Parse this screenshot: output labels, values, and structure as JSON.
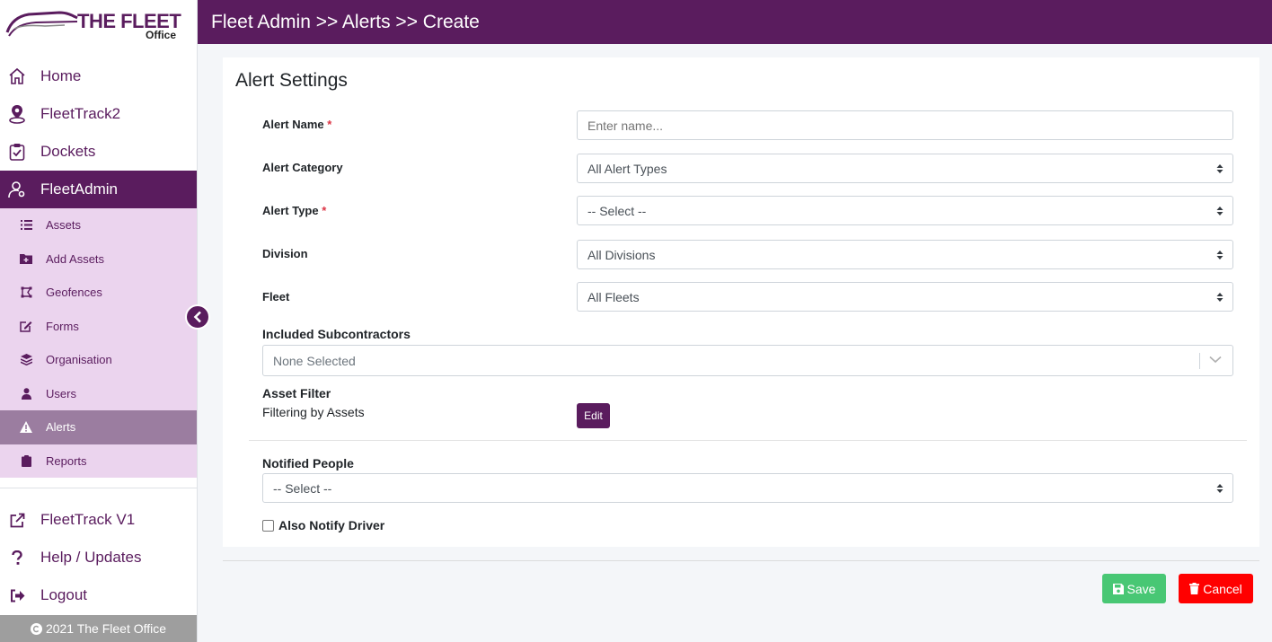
{
  "logo": {
    "brand": "THE FLEET",
    "sub": "Office"
  },
  "header": {
    "breadcrumb": "Fleet Admin >> Alerts >> Create"
  },
  "sidebar": {
    "main_items": [
      {
        "label": "Home",
        "icon": "home-icon"
      },
      {
        "label": "FleetTrack2",
        "icon": "map-pin-icon"
      },
      {
        "label": "Dockets",
        "icon": "clipboard-check-icon"
      },
      {
        "label": "FleetAdmin",
        "icon": "user-gear-icon",
        "active": true
      }
    ],
    "sub_items": [
      {
        "label": "Assets",
        "icon": "list-icon"
      },
      {
        "label": "Add Assets",
        "icon": "folder-plus-icon"
      },
      {
        "label": "Geofences",
        "icon": "draw-polygon-icon"
      },
      {
        "label": "Forms",
        "icon": "edit-icon"
      },
      {
        "label": "Organisation",
        "icon": "layers-icon"
      },
      {
        "label": "Users",
        "icon": "user-icon"
      },
      {
        "label": "Alerts",
        "icon": "warning-icon",
        "active": true
      },
      {
        "label": "Reports",
        "icon": "clipboard-icon"
      }
    ],
    "bottom_items": [
      {
        "label": "FleetTrack V1",
        "icon": "external-link-icon"
      },
      {
        "label": "Help / Updates",
        "icon": "question-icon"
      },
      {
        "label": "Logout",
        "icon": "sign-out-icon"
      }
    ],
    "footer": "2021 The Fleet Office"
  },
  "form": {
    "title": "Alert Settings",
    "alert_name": {
      "label": "Alert Name",
      "required": "*",
      "placeholder": "Enter name..."
    },
    "alert_category": {
      "label": "Alert Category",
      "value": "All Alert Types"
    },
    "alert_type": {
      "label": "Alert Type",
      "required": "*",
      "value": "-- Select --"
    },
    "division": {
      "label": "Division",
      "value": "All Divisions"
    },
    "fleet": {
      "label": "Fleet",
      "value": "All Fleets"
    },
    "subcontractors": {
      "label": "Included Subcontractors",
      "value": "None Selected"
    },
    "asset_filter": {
      "label": "Asset Filter",
      "text": "Filtering by Assets",
      "button": "Edit"
    },
    "notified_people": {
      "label": "Notified People",
      "value": "-- Select --"
    },
    "also_notify_driver": {
      "label": "Also Notify Driver",
      "checked": false
    }
  },
  "actions": {
    "save": "Save",
    "cancel": "Cancel"
  },
  "colors": {
    "brand": "#5a1c5e",
    "subnav_bg": "#ebd4ee",
    "save": "#48c774",
    "cancel": "#ff0000"
  }
}
